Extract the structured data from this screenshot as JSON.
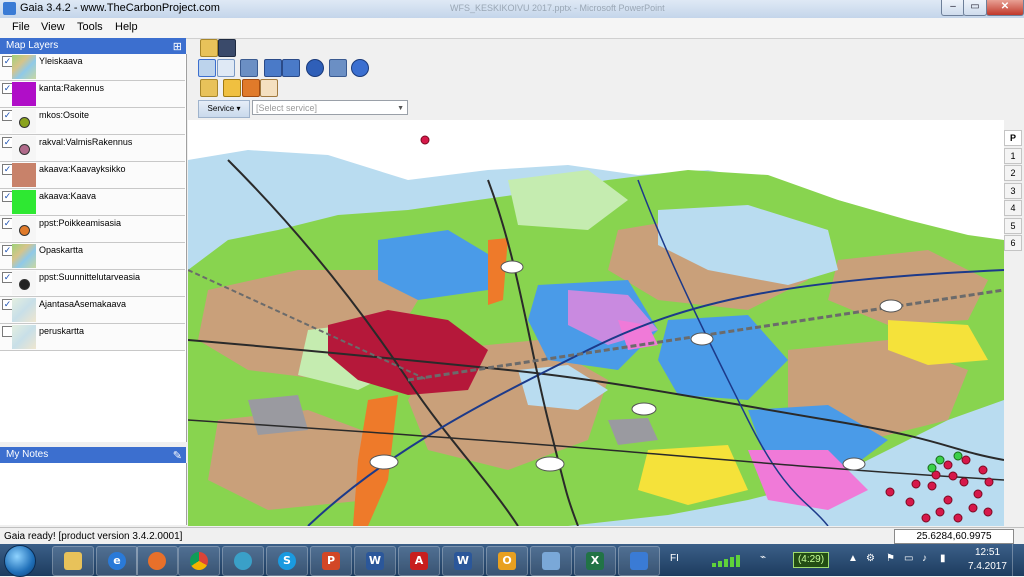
{
  "window": {
    "title": "Gaia 3.4.2 - www.TheCarbonProject.com",
    "background_title": "WFS_KESKIKOIVU 2017.pptx - Microsoft PowerPoint"
  },
  "menu": [
    "File",
    "View",
    "Tools",
    "Help"
  ],
  "layers_panel": {
    "title": "Map Layers",
    "layers": [
      {
        "name": "Yleiskaava",
        "checked": true,
        "swatch": "thumb"
      },
      {
        "name": "kanta:Rakennus",
        "checked": true,
        "swatch": "fill",
        "color": "#b00ec8"
      },
      {
        "name": "mkos:Osoite",
        "checked": true,
        "swatch": "dot",
        "color": "#8aa31e"
      },
      {
        "name": "rakval:ValmisRakennus",
        "checked": true,
        "swatch": "dot",
        "color": "#b06a8a"
      },
      {
        "name": "akaava:Kaavayksikko",
        "checked": true,
        "swatch": "fill",
        "color": "#c8826a"
      },
      {
        "name": "akaava:Kaava",
        "checked": true,
        "swatch": "fill",
        "color": "#2ee832"
      },
      {
        "name": "ppst:Poikkeamisasia",
        "checked": true,
        "swatch": "dot",
        "color": "#e07a2a"
      },
      {
        "name": "Opaskartta",
        "checked": true,
        "swatch": "thumb"
      },
      {
        "name": "ppst:Suunnittelutarveasia",
        "checked": true,
        "swatch": "dot",
        "color": "#222222"
      },
      {
        "name": "AjantasaAsemakaava",
        "checked": true,
        "swatch": "thumb-light"
      },
      {
        "name": "peruskartta",
        "checked": false,
        "swatch": "thumb-light"
      }
    ]
  },
  "notes_panel": {
    "title": "My Notes"
  },
  "toolbar": {
    "service_label": "Service",
    "service_placeholder": "[Select service]"
  },
  "pages": {
    "header": "P",
    "items": [
      "1",
      "2",
      "3",
      "4",
      "5",
      "6"
    ]
  },
  "status": {
    "text": "Gaia ready! [product version 3.4.2.0001]",
    "coords": "25.6284,60.9975"
  },
  "taskbar": {
    "lang": "FI",
    "battery": "(4:29)",
    "time": "12:51",
    "date": "7.4.2017"
  }
}
